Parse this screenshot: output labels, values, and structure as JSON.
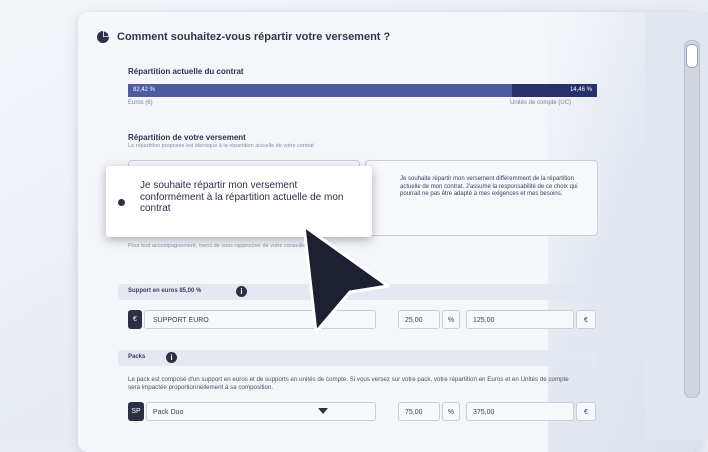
{
  "header": {
    "title": "Comment souhaitez-vous répartir votre versement ?",
    "icon": "pie-chart-icon"
  },
  "current_split": {
    "title": "Répartition actuelle du contrat",
    "euros_pct": "82,42 %",
    "uc_pct": "14,46 %",
    "euros_label": "Euros (6)",
    "uc_label": "Unités de compte (UC)",
    "bar_fraction": 0.82,
    "colors": {
      "euros": "#4e5ba0",
      "uc": "#28306a"
    }
  },
  "payment_split": {
    "title": "Répartition de votre versement",
    "subtitle": "La répartition proposée est identique à la répartition actuelle de votre contrat"
  },
  "options": {
    "conform": "Je souhaite répartir mon versement conformément à la répartition actuelle de mon contrat",
    "different": "Je souhaite répartir mon versement différemment de la répartition actuelle de mon contrat. J'assume la responsabilité de ce choix qui pourrait ne pas être adapté à mes exigences et mes besoins."
  },
  "advice_note": "Pour tout accompagnement, merci de vous rapprocher de votre conseiller",
  "euro_support": {
    "band_label": "Support en euros 85,00 %",
    "badge": "€",
    "name": "SUPPORT EURO",
    "pct": "25,00",
    "pct_unit": "%",
    "amount": "125,00",
    "currency": "€"
  },
  "packs": {
    "band_label": "Packs",
    "description": "Le pack est composé d'un support en euros et de supports en unités de compte. Si vous versez sur votre pack, votre répartition en Euros et en Unités de compte sera impactée proportionnellement à sa composition.",
    "badge": "SP",
    "selected": "Pack Duo",
    "pct": "75,00",
    "pct_unit": "%",
    "amount": "375,00",
    "currency": "€"
  }
}
